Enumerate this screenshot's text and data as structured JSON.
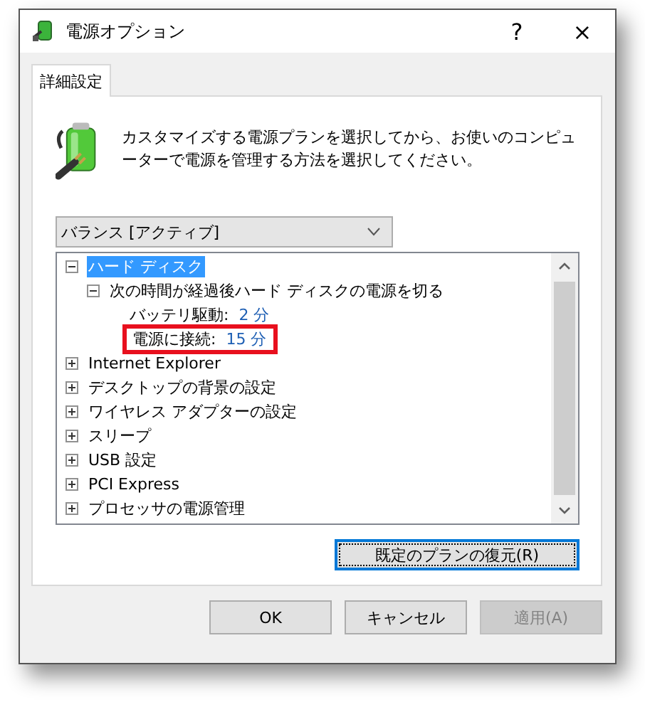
{
  "window": {
    "title": "電源オプション",
    "help": "?",
    "close": "×"
  },
  "tabs": [
    {
      "label": "詳細設定",
      "selected": true
    }
  ],
  "description": "カスタマイズする電源プランを選択してから、お使いのコンピューターで電源を管理する方法を選択してください。",
  "plan_dropdown": {
    "value": "バランス [アクティブ]"
  },
  "settings_tree": [
    {
      "label": "ハード ディスク",
      "expanded": true,
      "selected": true,
      "children": [
        {
          "label": "次の時間が経過後ハード ディスクの電源を切る",
          "expanded": true,
          "selected": false,
          "children": [
            {
              "label": "バッテリ駆動:",
              "value": "2 分",
              "selected": false,
              "annotated": false
            },
            {
              "label": "電源に接続:",
              "value": "15 分",
              "selected": false,
              "annotated": true
            }
          ]
        }
      ]
    },
    {
      "label": "Internet Explorer",
      "expanded": false,
      "selected": false
    },
    {
      "label": "デスクトップの背景の設定",
      "expanded": false,
      "selected": false
    },
    {
      "label": "ワイヤレス アダプターの設定",
      "expanded": false,
      "selected": false
    },
    {
      "label": "スリープ",
      "expanded": false,
      "selected": false
    },
    {
      "label": "USB 設定",
      "expanded": false,
      "selected": false
    },
    {
      "label": "PCI Express",
      "expanded": false,
      "selected": false
    },
    {
      "label": "プロセッサの電源管理",
      "expanded": false,
      "selected": false
    }
  ],
  "restore_button": {
    "label": "既定のプランの復元(R)",
    "focused": true
  },
  "buttons": [
    {
      "label": "OK",
      "disabled": false
    },
    {
      "label": "キャンセル",
      "disabled": false
    },
    {
      "label": "適用(A)",
      "disabled": true
    }
  ]
}
